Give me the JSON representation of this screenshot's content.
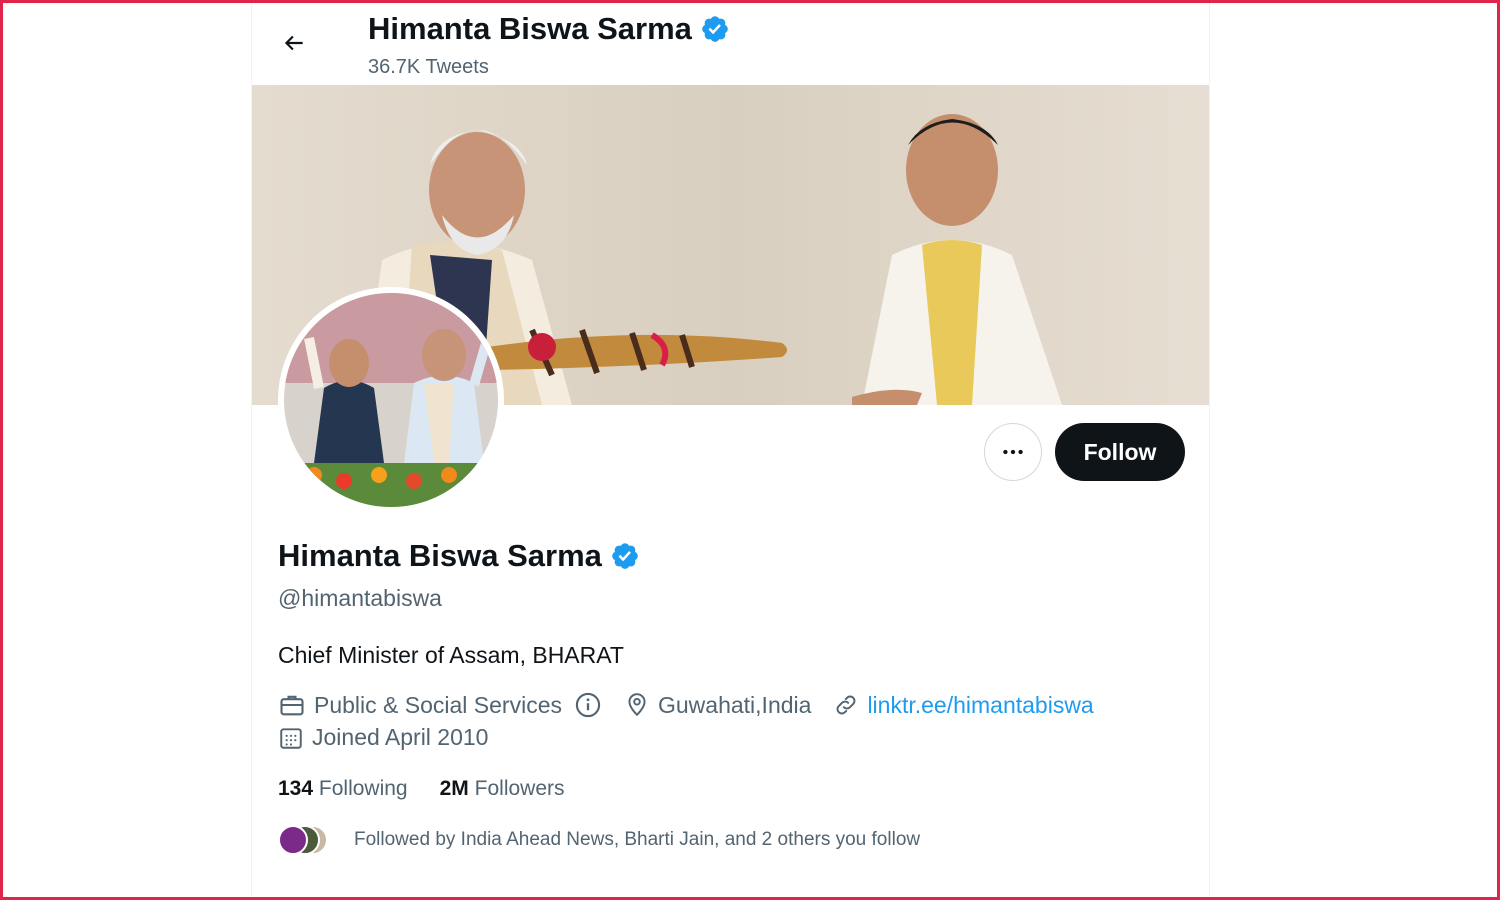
{
  "header": {
    "title": "Himanta Biswa Sarma",
    "tweet_count": "36.7K Tweets"
  },
  "profile": {
    "name": "Himanta Biswa Sarma",
    "handle": "@himantabiswa",
    "bio": "Chief Minister of Assam, BHARAT",
    "category": "Public & Social Services",
    "location": "Guwahati,India",
    "website": "linktr.ee/himantabiswa",
    "joined": "Joined April 2010",
    "following_count": "134",
    "following_label": "Following",
    "followers_count": "2M",
    "followers_label": "Followers",
    "followed_by": "Followed by India Ahead News, Bharti Jain, and 2 others you follow"
  },
  "actions": {
    "follow_label": "Follow"
  },
  "icons": {
    "back": "arrow-left-icon",
    "verified": "verified-badge-icon",
    "more": "more-horizontal-icon",
    "category": "briefcase-icon",
    "info": "info-icon",
    "location": "location-pin-icon",
    "link": "link-icon",
    "calendar": "calendar-icon"
  },
  "colors": {
    "accent": "#1d9bf0",
    "text_primary": "#0f1419",
    "text_secondary": "#536471",
    "frame": "#e0244a"
  }
}
